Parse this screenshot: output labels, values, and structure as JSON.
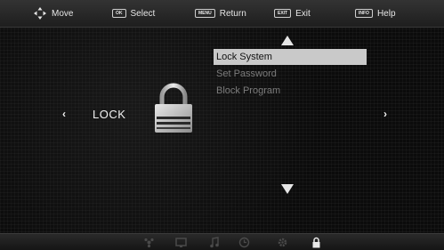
{
  "hints": [
    {
      "icon": "dpad-arrows-icon",
      "key": "",
      "label": "Move"
    },
    {
      "icon": "ok-key-icon",
      "key": "OK",
      "label": "Select"
    },
    {
      "icon": "menu-key-icon",
      "key": "MENU",
      "label": "Return"
    },
    {
      "icon": "exit-key-icon",
      "key": "EXIT",
      "label": "Exit"
    },
    {
      "icon": "info-key-icon",
      "key": "INFO",
      "label": "Help"
    }
  ],
  "panel": {
    "title": "LOCK",
    "left_arrow": "‹",
    "right_arrow": "›",
    "icon": "padlock-icon"
  },
  "menu": {
    "items": [
      {
        "label": "Lock System",
        "selected": true
      },
      {
        "label": "Set Password",
        "selected": false
      },
      {
        "label": "Block Program",
        "selected": false
      }
    ]
  },
  "bottom_bar": {
    "icons": [
      "satellite-icon",
      "picture-icon",
      "music-icon",
      "clock-icon",
      "gear-icon",
      "lock-icon"
    ],
    "active": "lock-icon"
  },
  "colors": {
    "background": "#0b0b0b",
    "text": "#f2f2f2",
    "selected_bg": "#c9c9c9",
    "dim_text": "#7c7c7c"
  }
}
